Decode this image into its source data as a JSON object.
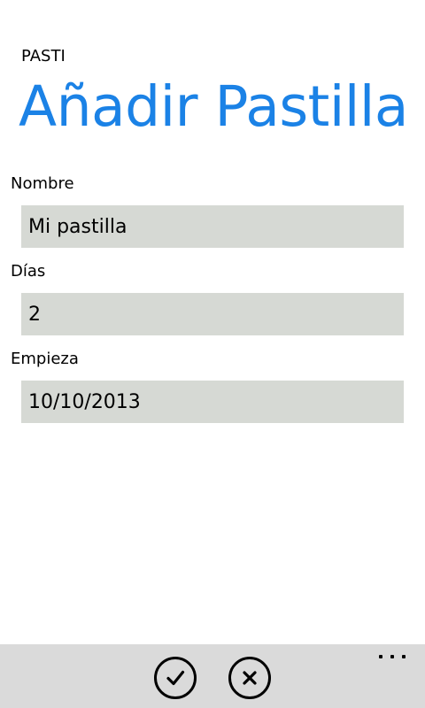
{
  "app": {
    "name": "PASTI",
    "page_title": "Añadir Pastilla",
    "accent_color": "#1b82e6"
  },
  "form": {
    "nombre": {
      "label": "Nombre",
      "value": "Mi pastilla"
    },
    "dias": {
      "label": "Días",
      "value": "2"
    },
    "empieza": {
      "label": "Empieza",
      "value": "10/10/2013"
    }
  },
  "app_bar": {
    "buttons": [
      {
        "icon": "check-icon"
      },
      {
        "icon": "close-icon"
      }
    ],
    "more_icon": "ellipsis-icon"
  }
}
